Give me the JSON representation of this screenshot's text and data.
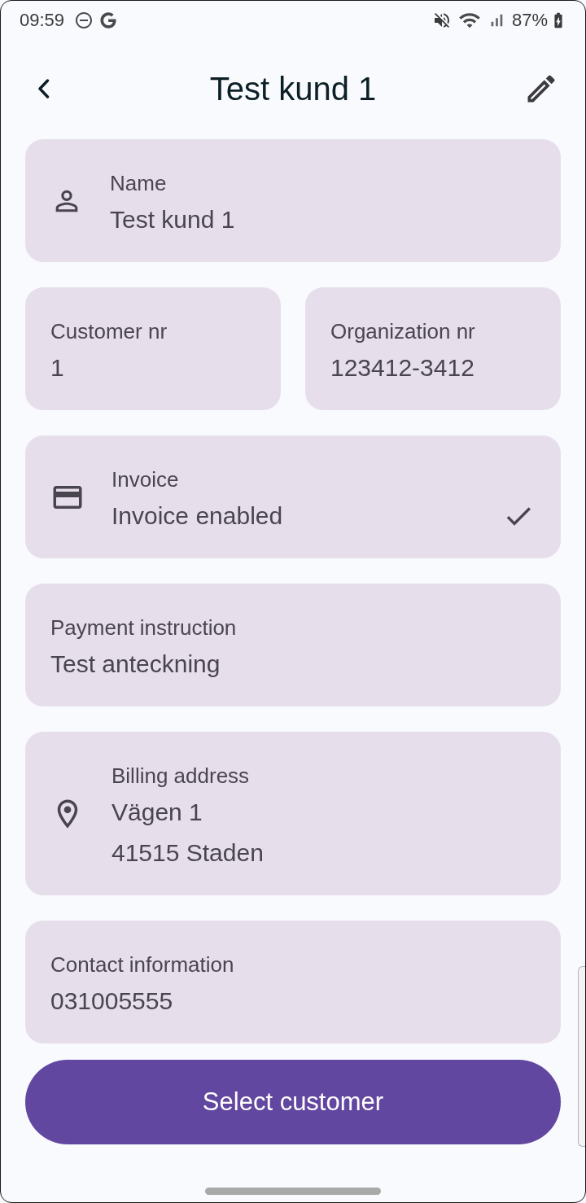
{
  "status_bar": {
    "time": "09:59",
    "battery": "87%"
  },
  "header": {
    "title": "Test kund 1"
  },
  "cards": [
    {
      "kind": "name",
      "label": "Name",
      "lines": [
        "Test kund 1"
      ]
    },
    {
      "kind": "pair",
      "items": [
        {
          "label": "Customer nr",
          "lines": [
            "1"
          ]
        },
        {
          "label": "Organization nr",
          "lines": [
            "123412-3412"
          ]
        }
      ]
    },
    {
      "kind": "invoice",
      "label": "Invoice",
      "lines": [
        "Invoice enabled"
      ],
      "checked": true
    },
    {
      "kind": "text",
      "label": "Payment instruction",
      "lines": [
        "Test anteckning"
      ]
    },
    {
      "kind": "address",
      "label": "Billing address",
      "lines": [
        "Vägen 1",
        "41515 Staden"
      ]
    },
    {
      "kind": "text",
      "label": "Contact information",
      "lines": [
        "031005555"
      ]
    }
  ],
  "primary_button": {
    "label": "Select customer"
  }
}
